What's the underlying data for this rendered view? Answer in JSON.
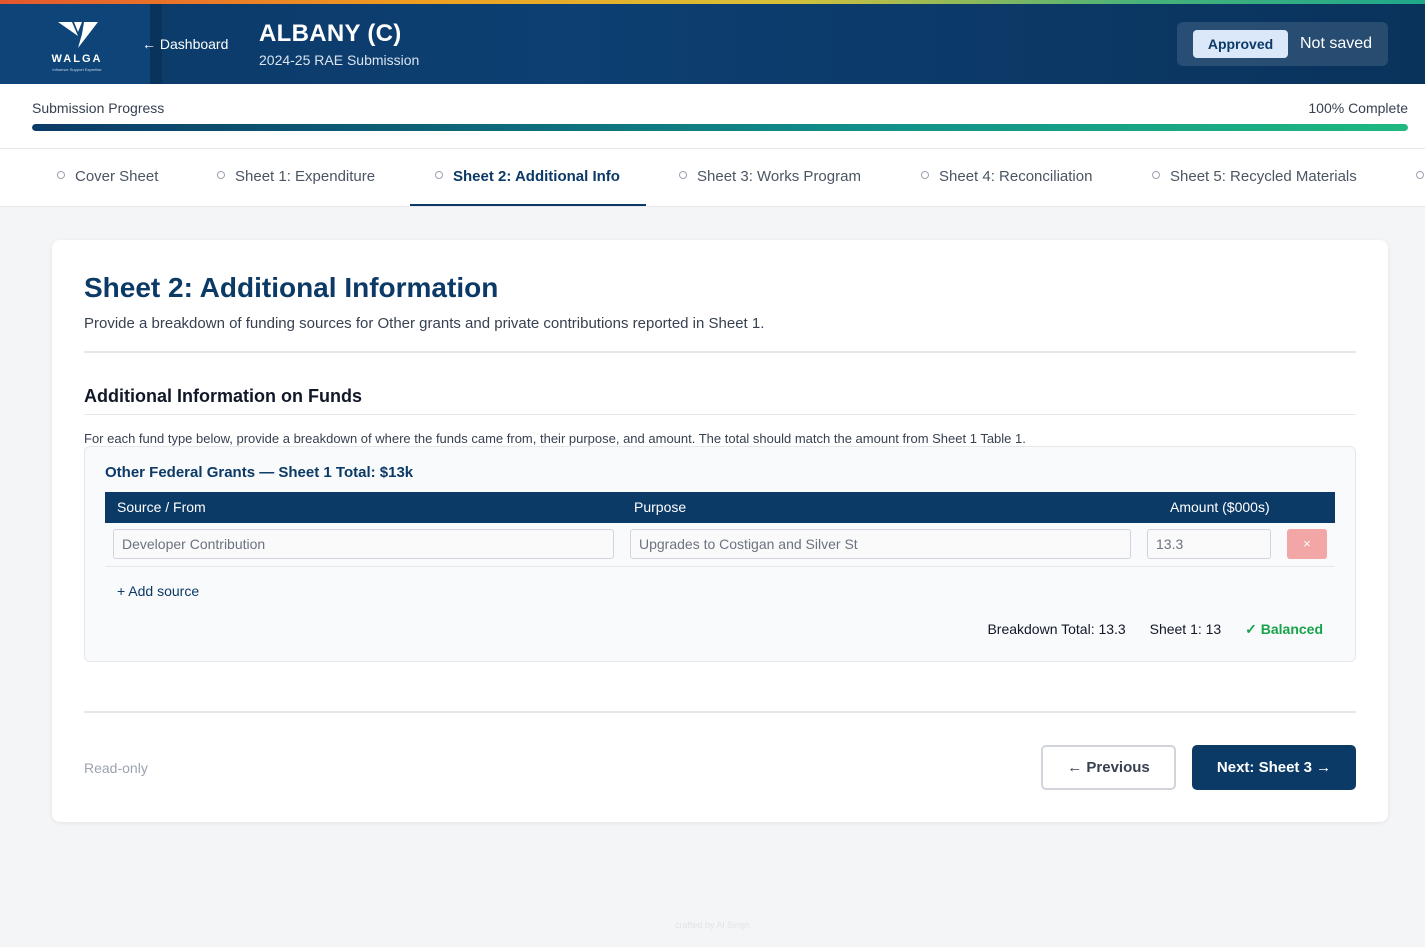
{
  "header": {
    "logo_text": "WALGA",
    "logo_tagline": "Influence Support Expertise",
    "back_label": "← Dashboard",
    "council_name": "ALBANY (C)",
    "submission_label": "2024-25 RAE Submission",
    "status_badge": "Approved",
    "save_status": "Not saved",
    "accent_color": "#0b3a67"
  },
  "progress": {
    "label": "Submission Progress",
    "percent_label": "100% Complete",
    "value_percent": 100
  },
  "tabs": [
    {
      "label": "Cover Sheet"
    },
    {
      "label": "Sheet 1: Expenditure"
    },
    {
      "label": "Sheet 2: Additional Info",
      "active": true
    },
    {
      "label": "Sheet 3: Works Program"
    },
    {
      "label": "Sheet 4: Reconciliation"
    },
    {
      "label": "Sheet 5: Recycled Materials"
    }
  ],
  "main": {
    "title": "Sheet 2: Additional Information",
    "description": "Provide a breakdown of funding sources for Other grants and private contributions reported in Sheet 1.",
    "section_title": "Additional Information on Funds",
    "section_description": "For each fund type below, provide a breakdown of where the funds came from, their purpose, and amount. The total should match the amount from Sheet 1 Table 1.",
    "fund": {
      "title": "Other Federal Grants — Sheet 1 Total: $13k",
      "columns": [
        "Source / From",
        "Purpose",
        "Amount ($000s)"
      ],
      "rows": [
        {
          "source": "Developer Contribution",
          "purpose": "Upgrades to Costigan and Silver St",
          "amount": "13.3"
        }
      ],
      "delete_label": "×",
      "add_source_label": "+ Add source",
      "breakdown_total": "Breakdown Total: 13.3",
      "sheet1_total": "Sheet 1: 13",
      "balance_status": "✓ Balanced"
    },
    "readonly_label": "Read-only",
    "prev_label": "← Previous",
    "next_label": "Next: Sheet 3 →"
  },
  "footer": {
    "credit": "crafted by Al Singh"
  }
}
